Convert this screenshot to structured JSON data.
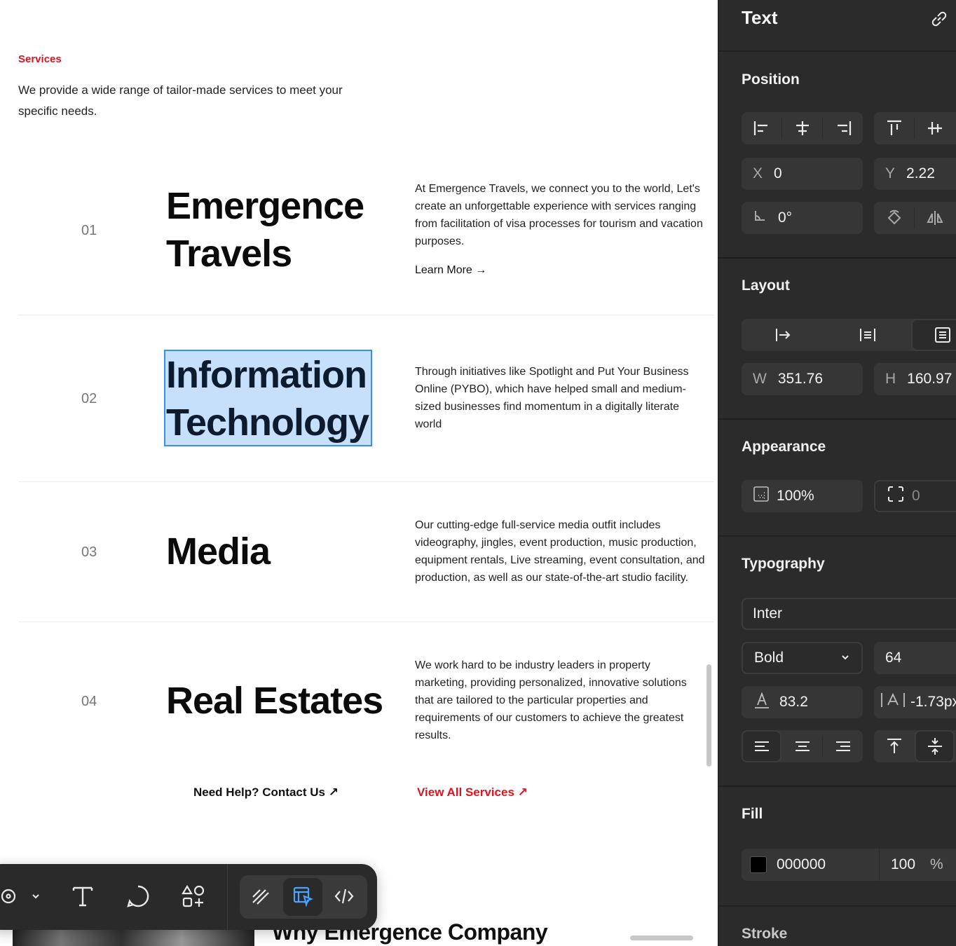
{
  "canvas": {
    "section_label": "Services",
    "intro": "We provide a wide range of tailor-made services to meet your specific needs.",
    "services": [
      {
        "num": "01",
        "title_line1": "Emergence",
        "title_line2": "Travels",
        "desc_lines": [
          "At Emergence Travels, we connect you to the world, Let's",
          "create an unforgettable experience with services ranging",
          "from facilitation of visa processes for tourism and vacation",
          "purposes."
        ],
        "link": "Learn More →"
      },
      {
        "num": "02",
        "title_line1": "Information",
        "title_line2": "Technology",
        "desc_lines": [
          "Through initiatives like Spotlight and Put Your Business",
          "Online (PYBO), which have helped small and medium-",
          "sized businesses find momentum in a digitally literate",
          "world"
        ]
      },
      {
        "num": "03",
        "title_line1": "Media",
        "desc_lines": [
          "Our cutting-edge full-service media outfit includes",
          "videography, jingles, event production, music production,",
          "equipment rentals, Live streaming, event consultation, and",
          "production, as well as our state-of-the-art studio facility."
        ]
      },
      {
        "num": "04",
        "title_line1": "Real Estates",
        "desc_lines": [
          "We work hard to be industry leaders in property",
          "marketing, providing personalized, innovative solutions",
          "that are tailored to the particular properties and",
          "requirements of our customers to achieve the greatest",
          "results."
        ]
      }
    ],
    "cta_help": "Need Help? Contact Us ↗",
    "cta_view": "View All Services ↗",
    "bottom_heading": "Why Emergence Company"
  },
  "panel": {
    "title": "Text",
    "position": {
      "heading": "Position",
      "x_label": "X",
      "x_value": "0",
      "y_label": "Y",
      "y_value": "2.22",
      "rotation": "0°"
    },
    "layout": {
      "heading": "Layout",
      "w_label": "W",
      "w_value": "351.76",
      "h_label": "H",
      "h_value": "160.97"
    },
    "appearance": {
      "heading": "Appearance",
      "opacity": "100%",
      "radius": "0"
    },
    "typography": {
      "heading": "Typography",
      "font": "Inter",
      "weight": "Bold",
      "size": "64",
      "line_height": "83.2",
      "letter_spacing": "-1.73px"
    },
    "fill": {
      "heading": "Fill",
      "hex": "000000",
      "opacity": "100",
      "unit": "%"
    },
    "stroke": {
      "heading": "Stroke"
    }
  },
  "colors": {
    "accent_red": "#e0141e",
    "selection_fill": "#c6e0fb",
    "selection_border": "#3b8fe8",
    "panel_bg": "#2b2b2b"
  }
}
